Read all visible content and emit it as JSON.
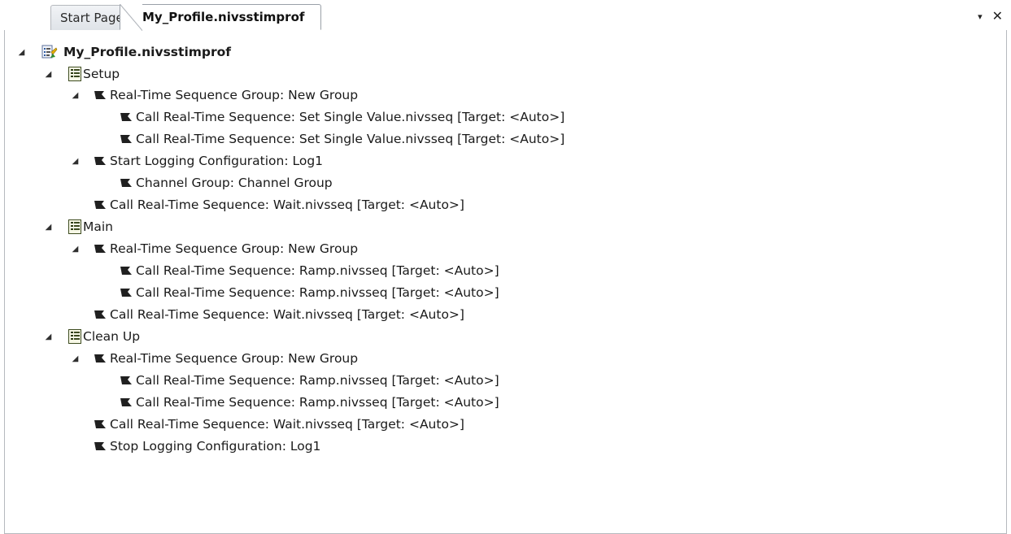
{
  "tabs": [
    {
      "label": "Start Page",
      "active": false
    },
    {
      "label": "My_Profile.nivsstimprof",
      "active": true
    }
  ],
  "window_controls": {
    "dropdown": "▾",
    "close": "✕"
  },
  "tree": {
    "root": "My_Profile.nivsstimprof",
    "setup": {
      "label": "Setup",
      "group": "Real-Time Sequence Group: New Group",
      "group_items": [
        "Call Real-Time Sequence: Set Single Value.nivsseq [Target: <Auto>]",
        "Call Real-Time Sequence: Set Single Value.nivsseq [Target: <Auto>]"
      ],
      "logging": "Start Logging Configuration: Log1",
      "logging_items": [
        "Channel Group: Channel Group"
      ],
      "wait": "Call Real-Time Sequence: Wait.nivsseq [Target: <Auto>]"
    },
    "main": {
      "label": "Main",
      "group": "Real-Time Sequence Group: New Group",
      "group_items": [
        "Call Real-Time Sequence: Ramp.nivsseq [Target: <Auto>]",
        "Call Real-Time Sequence: Ramp.nivsseq [Target: <Auto>]"
      ],
      "wait": "Call Real-Time Sequence: Wait.nivsseq [Target: <Auto>]"
    },
    "cleanup": {
      "label": "Clean Up",
      "group": "Real-Time Sequence Group: New Group",
      "group_items": [
        "Call Real-Time Sequence: Ramp.nivsseq [Target: <Auto>]",
        "Call Real-Time Sequence: Ramp.nivsseq [Target: <Auto>]"
      ],
      "wait": "Call Real-Time Sequence: Wait.nivsseq [Target: <Auto>]",
      "stop_logging": "Stop Logging Configuration: Log1"
    }
  },
  "icons": {
    "expanded": "expanded-triangle-icon",
    "profile": "stimulus-profile-icon",
    "section": "section-list-icon",
    "sequence": "sequence-flag-icon"
  },
  "colors": {
    "tab_border": "#b6b9be",
    "active_tab_bg": "#ffffff",
    "text": "#1a1a1a"
  }
}
